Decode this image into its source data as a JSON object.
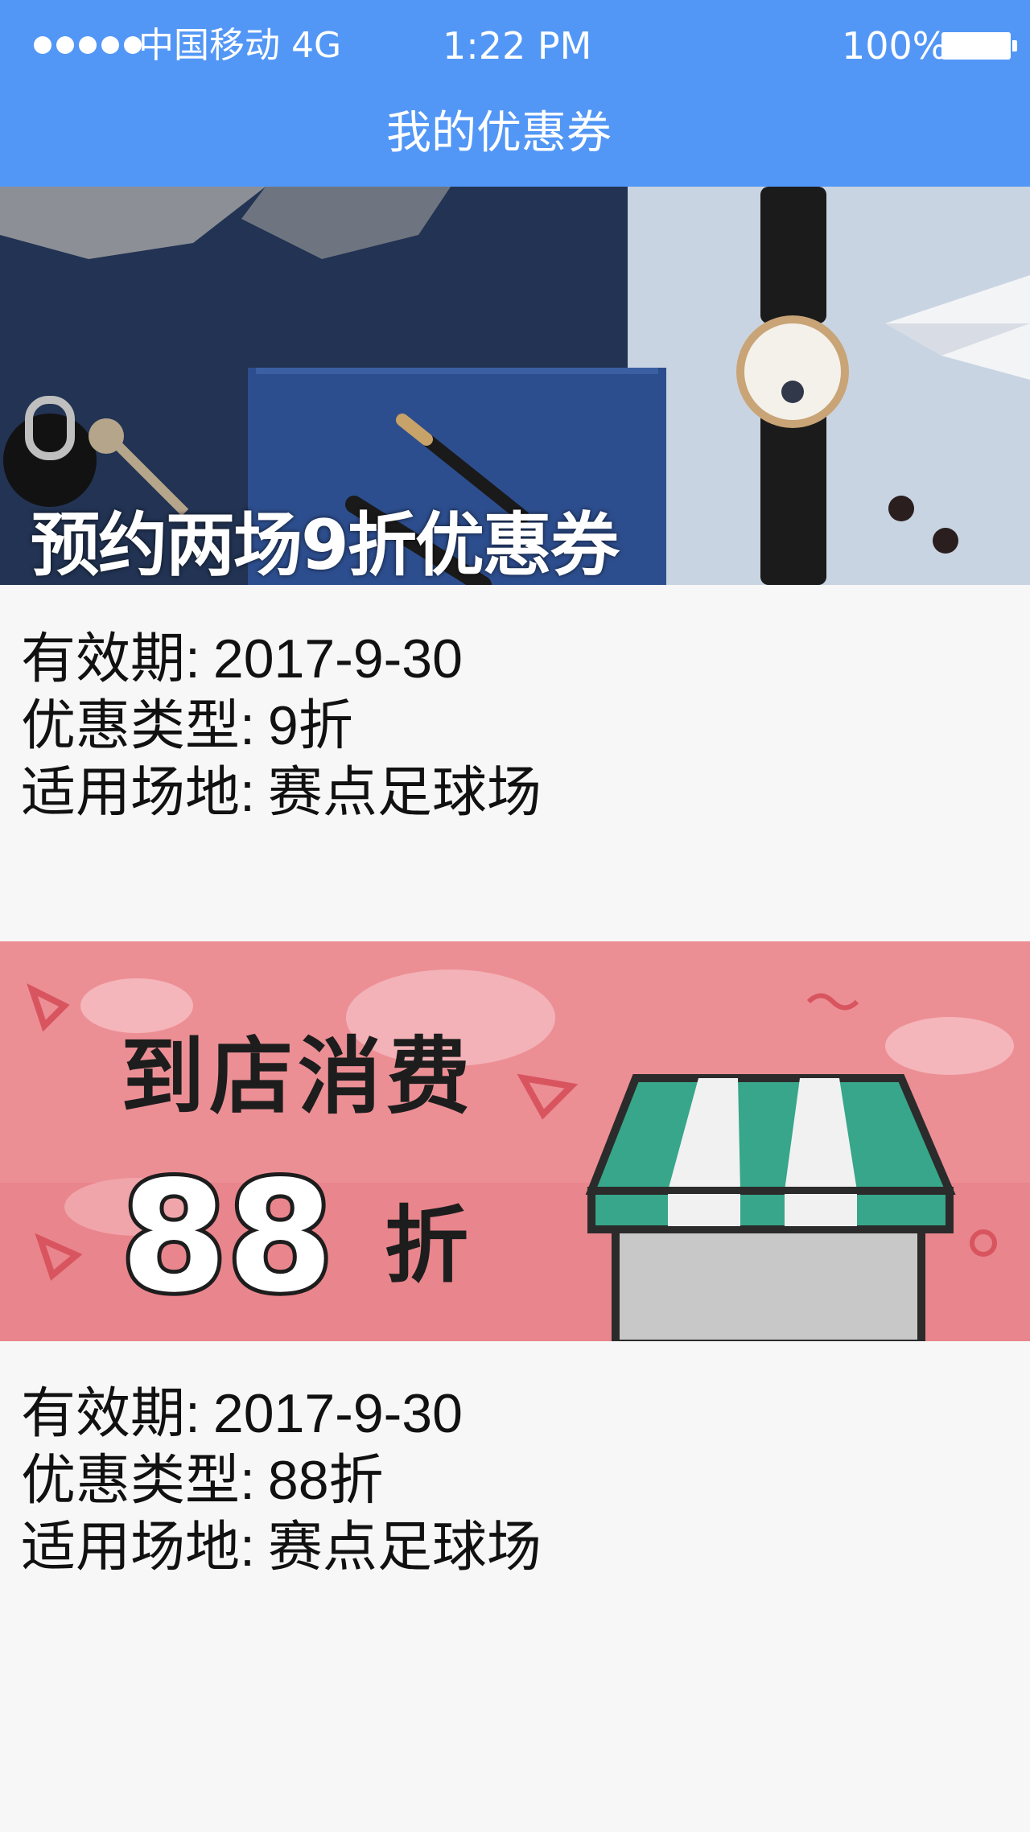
{
  "status_bar": {
    "carrier": "中国移动 4G",
    "time": "1:22 PM",
    "battery": "100%"
  },
  "nav": {
    "title": "我的优惠券"
  },
  "coupons": [
    {
      "banner_text": "预约两场9折优惠券",
      "validity_label": "有效期:",
      "validity_value": "2017-9-30",
      "type_label": "优惠类型:",
      "type_value": "9折",
      "venue_label": "适用场地:",
      "venue_value": "赛点足球场"
    },
    {
      "banner_title": "到店消费",
      "banner_number": "88",
      "banner_unit": "折",
      "validity_label": "有效期:",
      "validity_value": "2017-9-30",
      "type_label": "优惠类型:",
      "type_value": "88折",
      "venue_label": "适用场地:",
      "venue_value": "赛点足球场"
    }
  ],
  "colors": {
    "header": "#5397f6",
    "page_bg": "#f7f7f7",
    "banner2_bg": "#ec8f95"
  }
}
